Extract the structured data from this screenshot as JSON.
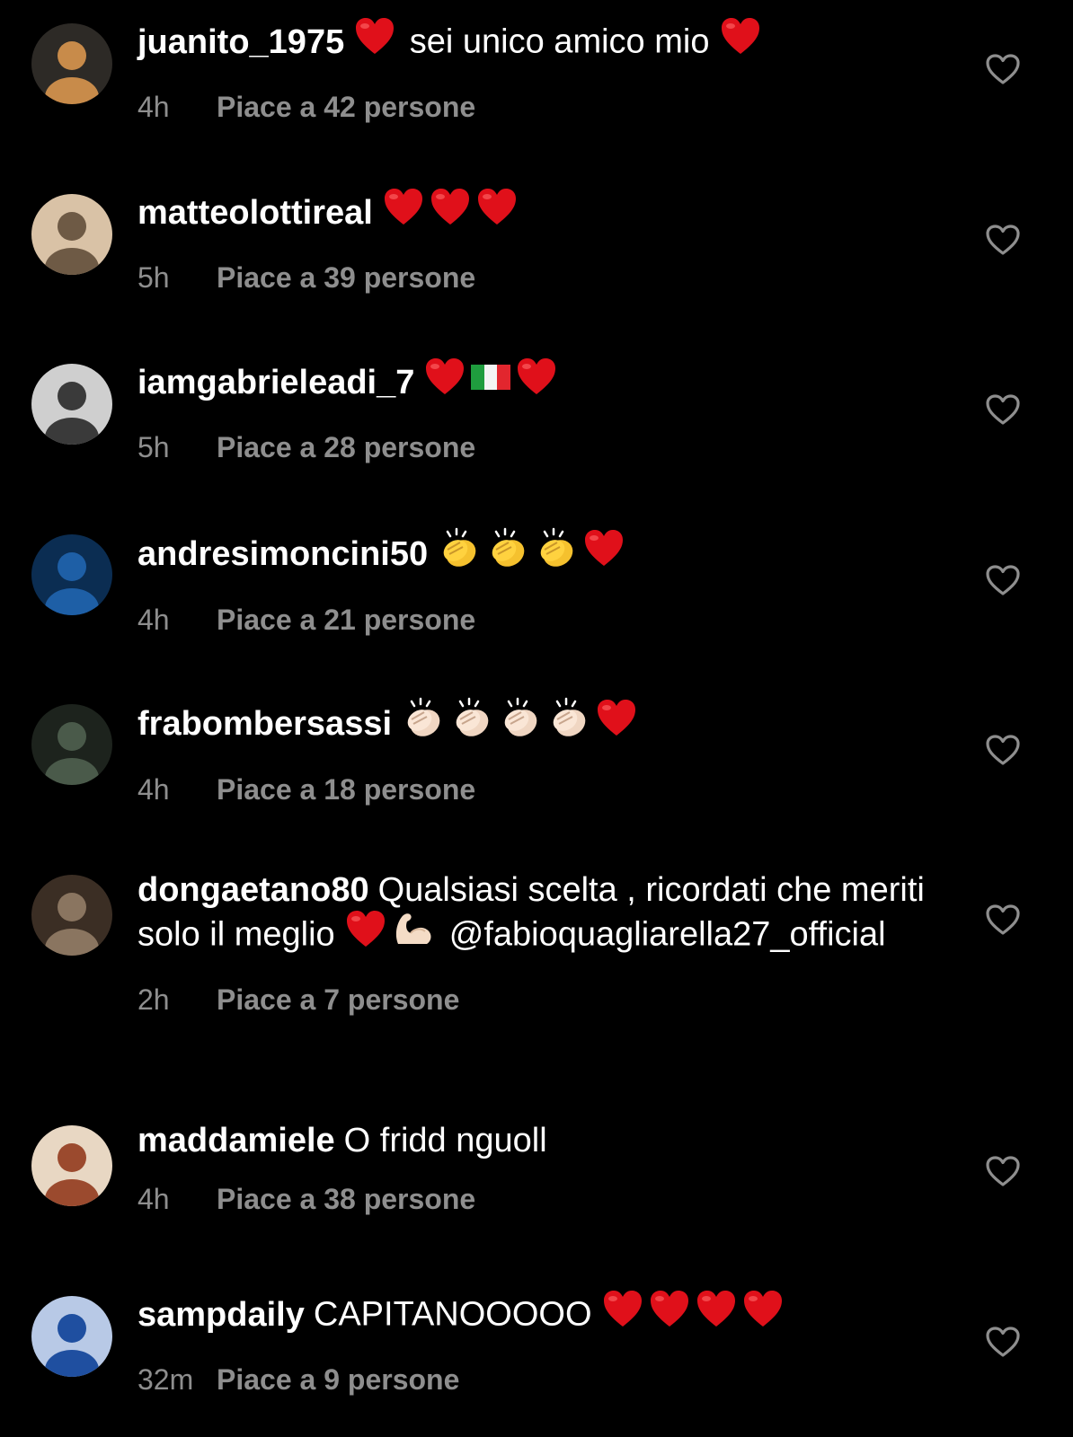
{
  "comments": [
    {
      "username": "juanito_1975",
      "parts": [
        {
          "type": "emoji",
          "name": "red-heart"
        },
        {
          "type": "text",
          "value": " sei unico amico mio "
        },
        {
          "type": "emoji",
          "name": "red-heart"
        }
      ],
      "time": "4h",
      "likes": "Piace a 42 persone",
      "avatar_colors": [
        "#c88b4a",
        "#2d2a26"
      ]
    },
    {
      "username": "matteolottireal",
      "parts": [
        {
          "type": "emoji",
          "name": "red-heart"
        },
        {
          "type": "emoji",
          "name": "red-heart"
        },
        {
          "type": "emoji",
          "name": "red-heart"
        }
      ],
      "time": "5h",
      "likes": "Piace a 39 persone",
      "avatar_colors": [
        "#6e5a45",
        "#d9c2a6"
      ]
    },
    {
      "username": "iamgabrieleadi_7",
      "parts": [
        {
          "type": "emoji",
          "name": "red-heart"
        },
        {
          "type": "emoji",
          "name": "italy-flag"
        },
        {
          "type": "emoji",
          "name": "red-heart"
        }
      ],
      "time": "5h",
      "likes": "Piace a 28 persone",
      "avatar_colors": [
        "#3a3a3a",
        "#cfcfcf"
      ]
    },
    {
      "username": "andresimoncini50",
      "parts": [
        {
          "type": "emoji",
          "name": "clapping-hands-yellow"
        },
        {
          "type": "emoji",
          "name": "clapping-hands-yellow"
        },
        {
          "type": "emoji",
          "name": "clapping-hands-yellow"
        },
        {
          "type": "emoji",
          "name": "red-heart"
        }
      ],
      "time": "4h",
      "likes": "Piace a 21 persone",
      "avatar_colors": [
        "#1e5fa6",
        "#0b2d52"
      ]
    },
    {
      "username": "frabombersassi",
      "parts": [
        {
          "type": "emoji",
          "name": "clapping-hands-light"
        },
        {
          "type": "emoji",
          "name": "clapping-hands-light"
        },
        {
          "type": "emoji",
          "name": "clapping-hands-light"
        },
        {
          "type": "emoji",
          "name": "clapping-hands-light"
        },
        {
          "type": "emoji",
          "name": "red-heart"
        }
      ],
      "time": "4h",
      "likes": "Piace a 18 persone",
      "avatar_colors": [
        "#4a5a4a",
        "#1d231d"
      ]
    },
    {
      "username": "dongaetano80",
      "parts": [
        {
          "type": "text",
          "value": "Qualsiasi scelta , ricordati che meriti solo il meglio "
        },
        {
          "type": "emoji",
          "name": "red-heart"
        },
        {
          "type": "emoji",
          "name": "flexed-biceps"
        },
        {
          "type": "text",
          "value": " @fabioquagliarella27_official"
        }
      ],
      "time": "2h",
      "likes": "Piace a 7 persone",
      "avatar_colors": [
        "#8a7560",
        "#3b2e24"
      ]
    },
    {
      "username": "maddamiele",
      "parts": [
        {
          "type": "text",
          "value": "O  fridd nguoll"
        }
      ],
      "time": "4h",
      "likes": "Piace a 38 persone",
      "avatar_colors": [
        "#9b4a2e",
        "#e8d7c3"
      ]
    },
    {
      "username": "sampdaily",
      "parts": [
        {
          "type": "text",
          "value": "CAPITANOOOOO "
        },
        {
          "type": "emoji",
          "name": "red-heart"
        },
        {
          "type": "emoji",
          "name": "red-heart"
        },
        {
          "type": "emoji",
          "name": "red-heart"
        },
        {
          "type": "emoji",
          "name": "red-heart"
        }
      ],
      "time": "32m",
      "likes": "Piace a 9 persone",
      "avatar_colors": [
        "#1f4fa0",
        "#b8c9e6"
      ]
    }
  ],
  "colors": {
    "background": "#000000",
    "text": "#ffffff",
    "secondary": "#8e8e8e",
    "heart": "#e0101a"
  }
}
